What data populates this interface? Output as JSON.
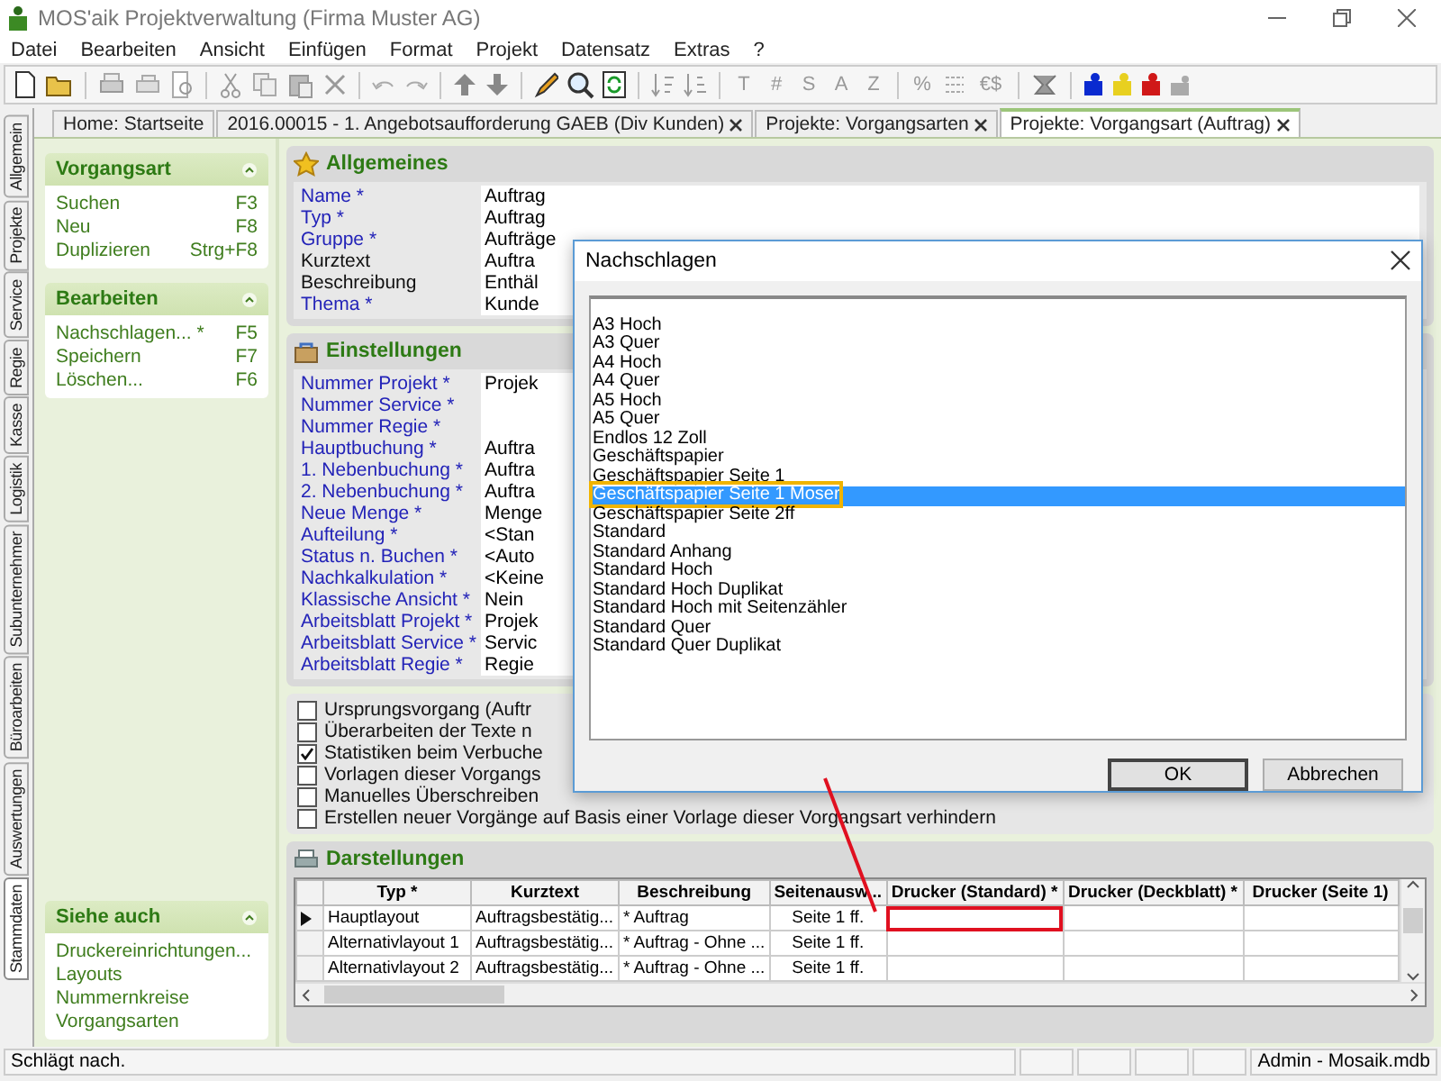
{
  "window": {
    "title": "MOS'aik Projektverwaltung (Firma Muster AG)"
  },
  "menu": [
    "Datei",
    "Bearbeiten",
    "Ansicht",
    "Einfügen",
    "Format",
    "Projekt",
    "Datensatz",
    "Extras",
    "?"
  ],
  "toolbar": {
    "letter_buttons": [
      "T",
      "#",
      "S",
      "A",
      "Z"
    ],
    "percent_button": "%",
    "currency_button": "€$"
  },
  "side_tabs": [
    {
      "label": "Allgemein",
      "selected": false
    },
    {
      "label": "Projekte",
      "selected": false
    },
    {
      "label": "Service",
      "selected": false
    },
    {
      "label": "Regie",
      "selected": false
    },
    {
      "label": "Kasse",
      "selected": false
    },
    {
      "label": "Logistik",
      "selected": false
    },
    {
      "label": "Subunternehmer",
      "selected": false
    },
    {
      "label": "Büroarbeiten",
      "selected": false
    },
    {
      "label": "Auswertungen",
      "selected": false
    },
    {
      "label": "Stammdaten",
      "selected": true
    }
  ],
  "doc_tabs": [
    {
      "label": "Home: Startseite",
      "closable": false,
      "selected": false
    },
    {
      "label": "2016.00015 - 1. Angebotsaufforderung GAEB (Div Kunden)",
      "closable": true,
      "selected": false
    },
    {
      "label": "Projekte: Vorgangsarten",
      "closable": true,
      "selected": false
    },
    {
      "label": "Projekte: Vorgangsart (Auftrag)",
      "closable": true,
      "selected": true
    }
  ],
  "task_panel": {
    "groups": [
      {
        "title": "Vorgangsart",
        "items": [
          {
            "label": "Suchen",
            "shortcut": "F3"
          },
          {
            "label": "Neu",
            "shortcut": "F8"
          },
          {
            "label": "Duplizieren",
            "shortcut": "Strg+F8"
          }
        ]
      },
      {
        "title": "Bearbeiten",
        "items": [
          {
            "label": "Nachschlagen... *",
            "shortcut": "F5"
          },
          {
            "label": "Speichern",
            "shortcut": "F7"
          },
          {
            "label": "Löschen...",
            "shortcut": "F6"
          }
        ]
      }
    ],
    "see_also": {
      "title": "Siehe auch",
      "items": [
        "Druckereinrichtungen...",
        "Layouts",
        "Nummernkreise",
        "Vorgangsarten"
      ]
    }
  },
  "general": {
    "title": "Allgemeines",
    "fields": [
      {
        "label": "Name *",
        "required": true,
        "value": "Auftrag"
      },
      {
        "label": "Typ *",
        "required": true,
        "value": "Auftrag"
      },
      {
        "label": "Gruppe *",
        "required": true,
        "value": "Aufträge"
      },
      {
        "label": "Kurztext",
        "required": false,
        "value": "Auftra"
      },
      {
        "label": "Beschreibung",
        "required": false,
        "value": "Enthäl"
      },
      {
        "label": "Thema *",
        "required": true,
        "value": "Kunde"
      }
    ]
  },
  "settings": {
    "title": "Einstellungen",
    "fields": [
      {
        "label": "Nummer Projekt *",
        "required": true,
        "value": "Projek"
      },
      {
        "label": "Nummer Service *",
        "required": true
      },
      {
        "label": "Nummer Regie *",
        "required": true
      },
      {
        "label": "Hauptbuchung *",
        "required": true,
        "value": "Auftra"
      },
      {
        "label": "1. Nebenbuchung *",
        "required": true,
        "value": "Auftra"
      },
      {
        "label": "2. Nebenbuchung *",
        "required": true,
        "value": "Auftra"
      },
      {
        "label": "Neue Menge *",
        "required": true,
        "value": "Menge"
      },
      {
        "label": "Aufteilung *",
        "required": true,
        "value": "<Stan"
      },
      {
        "label": "Status n. Buchen *",
        "required": true,
        "value": "<Auto"
      },
      {
        "label": "Nachkalkulation *",
        "required": true,
        "value": "<Keine"
      },
      {
        "label": "Klassische Ansicht *",
        "required": true,
        "value": "Nein"
      },
      {
        "label": "Arbeitsblatt Projekt *",
        "required": true,
        "value": "Projek"
      },
      {
        "label": "Arbeitsblatt Service *",
        "required": true,
        "value": "Servic"
      },
      {
        "label": "Arbeitsblatt Regie *",
        "required": true,
        "value": "Regie"
      }
    ],
    "options": [
      {
        "label": "Ursprungsvorgang (Auftr",
        "checked": false
      },
      {
        "label": "Überarbeiten der Texte n",
        "checked": false
      },
      {
        "label": "Statistiken beim Verbuche",
        "checked": true
      },
      {
        "label": "Vorlagen dieser Vorgangs",
        "checked": false
      },
      {
        "label": "Manuelles Überschreiben",
        "checked": false
      },
      {
        "label": "Erstellen neuer Vorgänge auf Basis einer Vorlage dieser Vorgangsart verhindern",
        "checked": false
      }
    ]
  },
  "layouts": {
    "title": "Darstellungen",
    "columns": [
      "Typ *",
      "Kurztext",
      "Beschreibung",
      "Seitenausw...",
      "Drucker (Standard) *",
      "Drucker (Deckblatt) *",
      "Drucker (Seite 1)"
    ],
    "rows": [
      {
        "current": true,
        "marked": true,
        "type": "Hauptlayout",
        "short_text": "Auftragsbestätig...",
        "description": "* Auftrag",
        "pages": "Seite 1 ff."
      },
      {
        "current": false,
        "marked": false,
        "type": "Alternativlayout 1",
        "short_text": "Auftragsbestätig...",
        "description": "* Auftrag - Ohne ...",
        "pages": "Seite 1 ff."
      },
      {
        "current": false,
        "marked": false,
        "type": "Alternativlayout 2",
        "short_text": "Auftragsbestätig...",
        "description": "* Auftrag - Ohne ...",
        "pages": "Seite 1 ff."
      }
    ]
  },
  "dialog": {
    "title": "Nachschlagen",
    "items": [
      {
        "label": "A3 Hoch",
        "selected": false
      },
      {
        "label": "A3 Quer",
        "selected": false
      },
      {
        "label": "A4 Hoch",
        "selected": false
      },
      {
        "label": "A4 Quer",
        "selected": false
      },
      {
        "label": "A5 Hoch",
        "selected": false
      },
      {
        "label": "A5 Quer",
        "selected": false
      },
      {
        "label": "Endlos 12 Zoll",
        "selected": false
      },
      {
        "label": "Geschäftspapier",
        "selected": false
      },
      {
        "label": "Geschäftspapier Seite 1",
        "selected": false
      },
      {
        "label": "Geschäftspapier Seite 1 Moser",
        "selected": true
      },
      {
        "label": "Geschäftspapier Seite 2ff",
        "selected": false
      },
      {
        "label": "Standard",
        "selected": false
      },
      {
        "label": "Standard Anhang",
        "selected": false
      },
      {
        "label": "Standard Hoch",
        "selected": false
      },
      {
        "label": "Standard Hoch Duplikat",
        "selected": false
      },
      {
        "label": "Standard Hoch mit Seitenzähler",
        "selected": false
      },
      {
        "label": "Standard Quer",
        "selected": false
      },
      {
        "label": "Standard Quer Duplikat",
        "selected": false
      }
    ],
    "buttons": [
      {
        "label": "OK",
        "default": true
      },
      {
        "label": "Abbrechen",
        "default": false
      }
    ]
  },
  "status_bar": {
    "message": "Schlägt nach.",
    "info": "Admin - Mosaik.mdb"
  }
}
